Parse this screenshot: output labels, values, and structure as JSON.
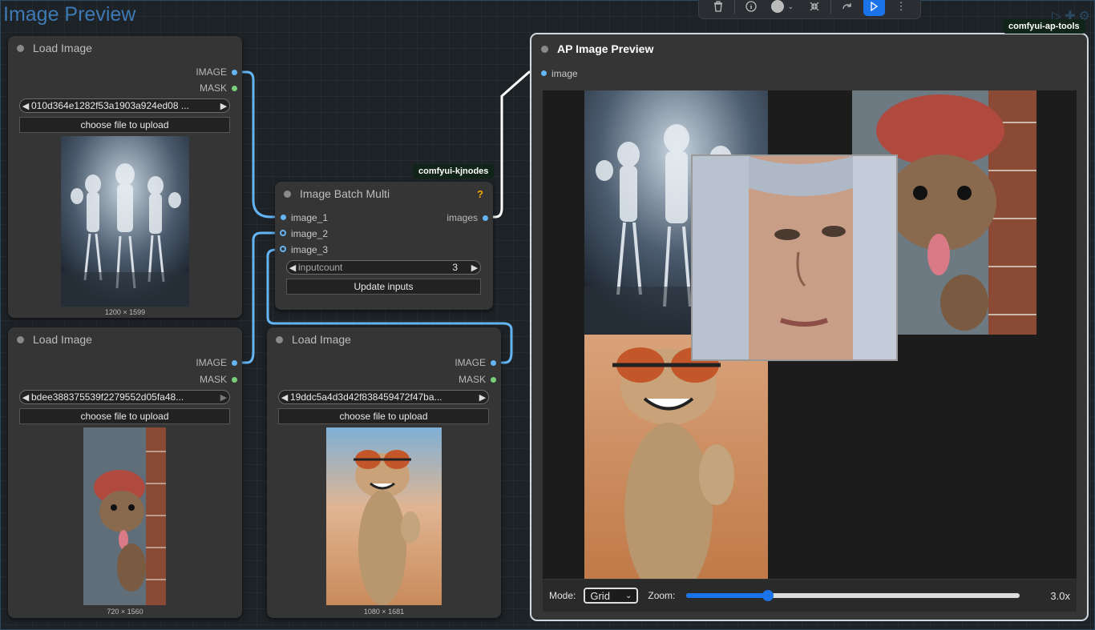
{
  "canvas": {
    "title": "Image Preview"
  },
  "toolbar": {
    "items": [
      "trash-icon",
      "info-icon",
      "color-circle-icon",
      "collapse-icon",
      "redo-icon",
      "run-icon",
      "more-icon"
    ]
  },
  "nodes": {
    "load1": {
      "title": "Load Image",
      "out_image": "IMAGE",
      "out_mask": "MASK",
      "filename": "010d364e1282f53a1903a924ed08 ...",
      "upload": "choose file to upload",
      "dims": "1200 × 1599"
    },
    "load2": {
      "title": "Load Image",
      "out_image": "IMAGE",
      "out_mask": "MASK",
      "filename": "bdee388375539f2279552d05fa48...",
      "upload": "choose file to upload",
      "dims": "720 × 1560"
    },
    "load3": {
      "title": "Load Image",
      "out_image": "IMAGE",
      "out_mask": "MASK",
      "filename": "19ddc5a4d3d42f838459472f47ba...",
      "upload": "choose file to upload",
      "dims": "1080 × 1681"
    },
    "batch": {
      "badge": "comfyui-kjnodes",
      "title": "Image Batch Multi",
      "help": "?",
      "in1": "image_1",
      "in2": "image_2",
      "in3": "image_3",
      "out": "images",
      "inputcount_label": "inputcount",
      "inputcount_value": "3",
      "update": "Update inputs"
    },
    "ap": {
      "badge": "comfyui-ap-tools",
      "title": "AP Image Preview",
      "in": "image",
      "mode_label": "Mode:",
      "mode_value": "Grid",
      "zoom_label": "Zoom:",
      "zoom_value": "3.0x",
      "zoom_fraction": 0.245
    }
  },
  "colors": {
    "link": "#64b5f6",
    "accent": "#1a73e8",
    "badge_bg": "#10241a"
  }
}
